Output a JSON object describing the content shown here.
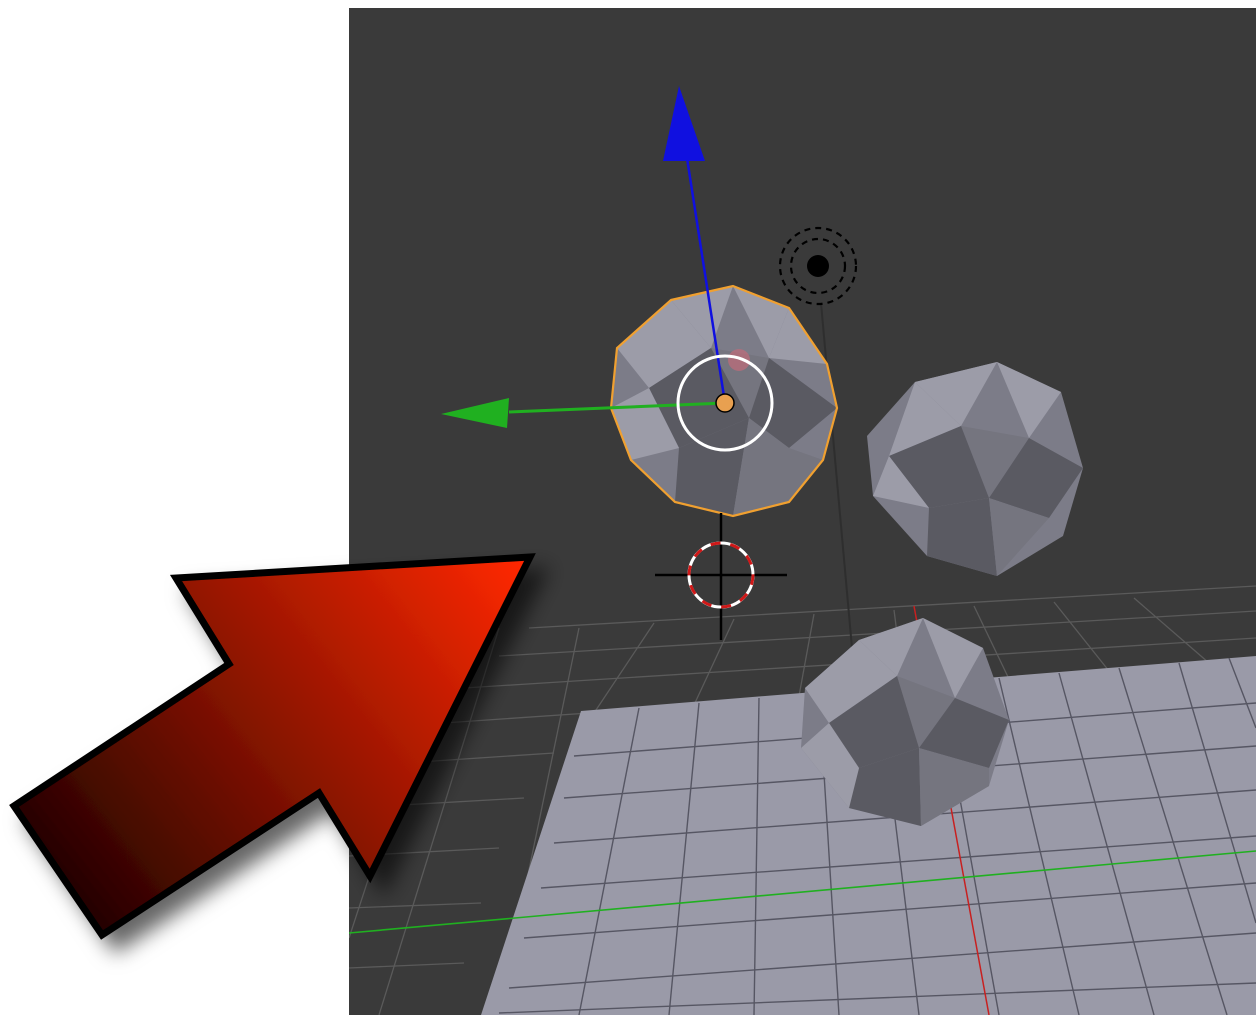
{
  "viewport": {
    "background": "#3a3a3a",
    "grid_line_color": "#5a5a5a",
    "ground_plane_color": "#9a9aa8",
    "ground_grid_color": "#565663"
  },
  "axes": {
    "x_axis_color": "#c82020",
    "y_axis_color": "#20b020",
    "z_axis_color": "#1010e0"
  },
  "objects": {
    "selected_outline_color": "#f0a030",
    "origin_color": "#e8a050",
    "sphere_light": "#9c9ca8",
    "sphere_dark": "#5a5a62"
  },
  "icons": {
    "manipulator": "transform-manipulator-icon",
    "lamp": "lamp-icon",
    "cursor": "3d-cursor-icon",
    "callout": "red-arrow-callout"
  },
  "callout": {
    "fill_start": "#1a0000",
    "fill_end": "#ff2800",
    "stroke": "#000000"
  }
}
